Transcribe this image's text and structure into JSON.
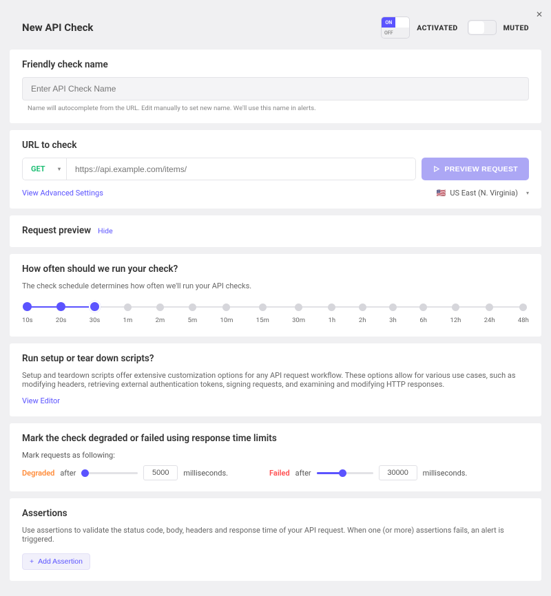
{
  "header": {
    "title": "New API Check",
    "activated_toggle": {
      "on_label": "ON",
      "off_label": "OFF",
      "state": "on"
    },
    "activated_text": "ACTIVATED",
    "muted_text": "MUTED"
  },
  "name_section": {
    "heading": "Friendly check name",
    "placeholder": "Enter API Check Name",
    "hint": "Name will autocomplete from the URL. Edit manually to set new name. We'll use this name in alerts."
  },
  "url_section": {
    "heading": "URL to check",
    "method": "GET",
    "placeholder": "https://api.example.com/items/",
    "preview_btn": "PREVIEW REQUEST",
    "advanced_link": "View Advanced Settings",
    "region_flag": "🇺🇸",
    "region": "US East (N. Virginia)"
  },
  "preview_section": {
    "heading": "Request preview",
    "hide": "Hide"
  },
  "schedule_section": {
    "heading": "How often should we run your check?",
    "desc": "The check schedule determines how often we'll run your API checks.",
    "ticks": [
      "10s",
      "20s",
      "30s",
      "1m",
      "2m",
      "5m",
      "10m",
      "15m",
      "30m",
      "1h",
      "2h",
      "3h",
      "6h",
      "12h",
      "24h",
      "48h"
    ],
    "selected_index": 2
  },
  "scripts_section": {
    "heading": "Run setup or tear down scripts?",
    "desc": "Setup and teardown scripts offer extensive customization options for any API request workflow. These options allow for various use cases, such as modifying headers, retrieving external authentication tokens, signing requests, and examining and modifying HTTP responses.",
    "view_editor": "View Editor"
  },
  "limits_section": {
    "heading": "Mark the check degraded or failed using response time limits",
    "sub": "Mark requests as following:",
    "degraded_label": "Degraded",
    "failed_label": "Failed",
    "after_label": "after",
    "ms_label": "milliseconds.",
    "degraded_value": "5000",
    "failed_value": "30000"
  },
  "assertions_section": {
    "heading": "Assertions",
    "desc": "Use assertions to validate the status code, body, headers and response time of your API request. When one (or more) assertions fails, an alert is triggered.",
    "add_btn": "Add Assertion"
  }
}
